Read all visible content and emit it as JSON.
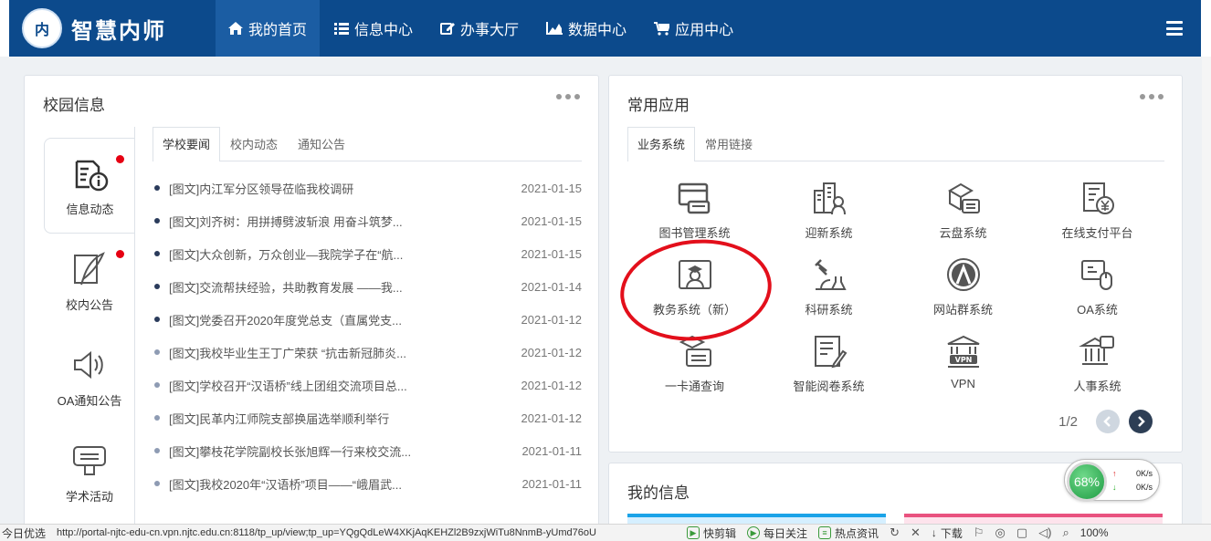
{
  "header": {
    "logo_seal": "内",
    "app_title": "智慧内师",
    "nav": [
      {
        "label": "我的首页",
        "icon": "home-icon",
        "active": true
      },
      {
        "label": "信息中心",
        "icon": "list-icon",
        "active": false
      },
      {
        "label": "办事大厅",
        "icon": "edit-icon",
        "active": false
      },
      {
        "label": "数据中心",
        "icon": "area-chart-icon",
        "active": false
      },
      {
        "label": "应用中心",
        "icon": "cart-icon",
        "active": false
      }
    ]
  },
  "campus": {
    "title": "校园信息",
    "side": [
      {
        "label": "信息动态",
        "icon": "info-doc-icon",
        "unread": true,
        "active": true
      },
      {
        "label": "校内公告",
        "icon": "quill-icon",
        "unread": true,
        "active": false
      },
      {
        "label": "OA通知公告",
        "icon": "speaker-icon",
        "unread": false,
        "active": false
      },
      {
        "label": "学术活动",
        "icon": "board-icon",
        "unread": false,
        "active": false
      }
    ],
    "tabs": [
      "学校要闻",
      "校内动态",
      "通知公告"
    ],
    "news": [
      {
        "title": "[图文]内江军分区领导莅临我校调研",
        "date": "2021-01-15"
      },
      {
        "title": "[图文]刘齐树：用拼搏劈波斩浪 用奋斗筑梦...",
        "date": "2021-01-15"
      },
      {
        "title": "[图文]大众创新，万众创业—我院学子在“航...",
        "date": "2021-01-15"
      },
      {
        "title": "[图文]交流帮扶经验，共助教育发展 ——我...",
        "date": "2021-01-14"
      },
      {
        "title": "[图文]党委召开2020年度党总支（直属党支...",
        "date": "2021-01-12"
      },
      {
        "title": "[图文]我校毕业生王丁广荣获 “抗击新冠肺炎...",
        "date": "2021-01-12"
      },
      {
        "title": "[图文]学校召开“汉语桥”线上团组交流项目总...",
        "date": "2021-01-12"
      },
      {
        "title": "[图文]民革内江师院支部换届选举顺利举行",
        "date": "2021-01-12"
      },
      {
        "title": "[图文]攀枝花学院副校长张旭辉一行来校交流...",
        "date": "2021-01-11"
      },
      {
        "title": "[图文]我校2020年“汉语桥”项目——“峨眉武...",
        "date": "2021-01-11"
      }
    ]
  },
  "apps": {
    "title": "常用应用",
    "tabs": [
      "业务系统",
      "常用链接"
    ],
    "items": [
      {
        "label": "图书管理系统",
        "icon": "library-icon"
      },
      {
        "label": "迎新系统",
        "icon": "welcome-icon"
      },
      {
        "label": "云盘系统",
        "icon": "cloud-disk-icon"
      },
      {
        "label": "在线支付平台",
        "icon": "payment-icon"
      },
      {
        "label": "教务系统（新）",
        "icon": "graduate-icon"
      },
      {
        "label": "科研系统",
        "icon": "microscope-icon"
      },
      {
        "label": "网站群系统",
        "icon": "website-icon"
      },
      {
        "label": "OA系统",
        "icon": "oa-icon"
      },
      {
        "label": "一卡通查询",
        "icon": "card-icon"
      },
      {
        "label": "智能阅卷系统",
        "icon": "grading-icon"
      },
      {
        "label": "VPN",
        "icon": "vpn-icon"
      },
      {
        "label": "人事系统",
        "icon": "hr-icon"
      }
    ],
    "page": "1/2"
  },
  "myinfo": {
    "title": "我的信息"
  },
  "netmonitor": {
    "percent": "68%",
    "up": "0K/s",
    "down": "0K/s"
  },
  "statusbar": {
    "left": "今日优选",
    "url": "http://portal-njtc-edu-cn.vpn.njtc.edu.cn:8118/tp_up/view;tp_up=YQgQdLeW4XKjAqKEHZl2B9zxjWiTu8NnmB-yUmd76oU",
    "items": [
      "快剪辑",
      "每日关注",
      "热点资讯"
    ],
    "download": "下载",
    "zoom": "100%"
  },
  "colors": {
    "nav_bg": "#0c4a8c",
    "nav_active": "#1b5da3",
    "unread_dot": "#e60012",
    "highlight_ring": "#e30f1b"
  }
}
